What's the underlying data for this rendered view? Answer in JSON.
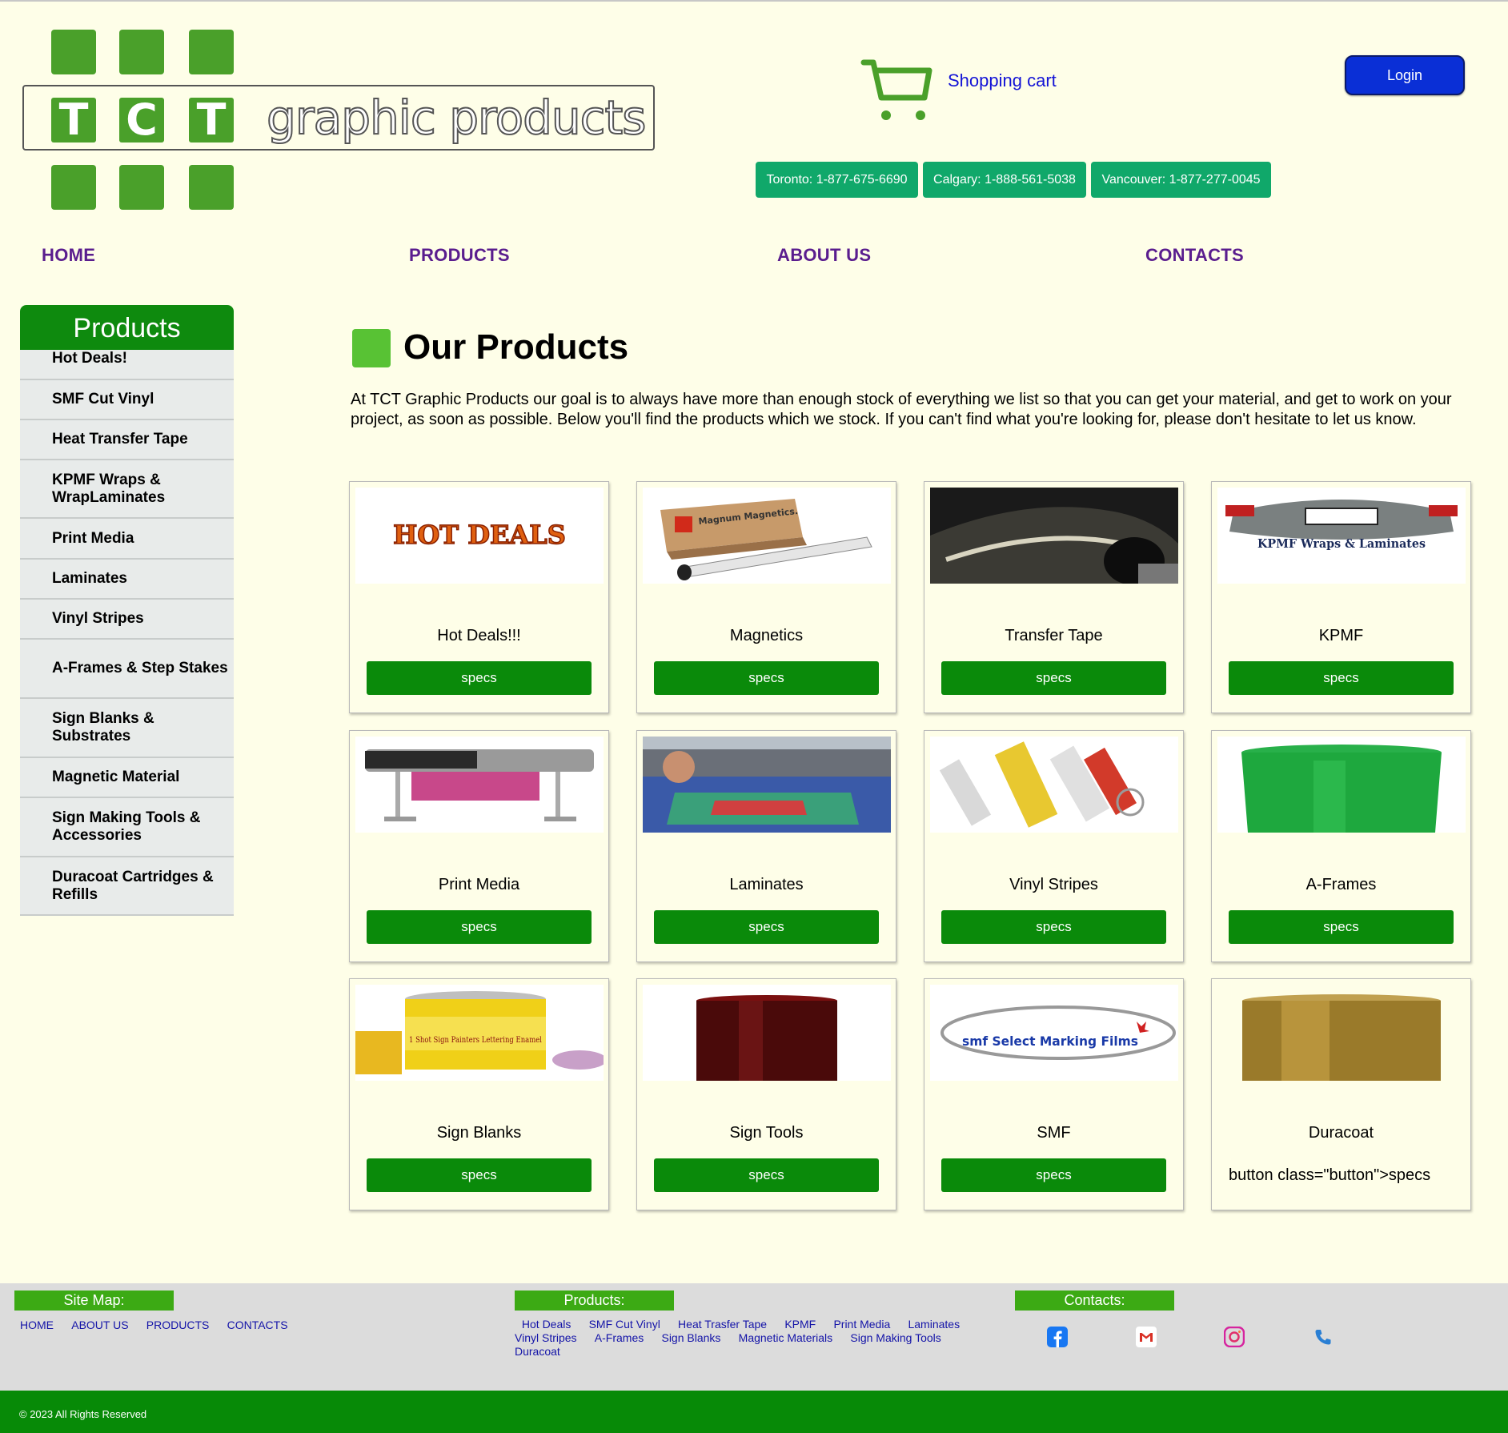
{
  "header": {
    "logo_letters": [
      "T",
      "C",
      "T"
    ],
    "logo_text": "graphic products",
    "cart_label": "Shopping cart",
    "login_label": "Login",
    "phones": [
      "Toronto: 1-877-675-6690",
      "Calgary: 1-888-561-5038",
      "Vancouver: 1-877-277-0045"
    ]
  },
  "nav": [
    "HOME",
    "PRODUCTS",
    "ABOUT US",
    "CONTACTS"
  ],
  "sidebar": {
    "title": "Products",
    "items": [
      "Hot Deals!",
      "SMF Cut Vinyl",
      "Heat Transfer Tape",
      "KPMF Wraps & WrapLaminates",
      "Print Media",
      "Laminates",
      "Vinyl Stripes",
      "A-Frames & Step Stakes",
      "Sign Blanks & Substrates",
      "Magnetic Material",
      "Sign Making Tools & Accessories",
      "Duracoat Cartridges & Refills"
    ]
  },
  "main": {
    "heading": "Our Products",
    "intro": "At TCT Graphic Products our goal is to always have more than enough stock of everything we list so that you can get your material, and get to work on your project, as soon as possible. Below you'll find the products which we stock. If you can't find what you're looking for, please don't hesitate to let us know.",
    "specs_label": "specs",
    "products": [
      {
        "title": "Hot Deals!!!",
        "image_text": "HOT DEALS"
      },
      {
        "title": "Magnetics",
        "image_text": "Magnum Magnetics."
      },
      {
        "title": "Transfer Tape"
      },
      {
        "title": "KPMF",
        "image_text": "KPMF Wraps & Laminates"
      },
      {
        "title": "Print Media"
      },
      {
        "title": "Laminates"
      },
      {
        "title": "Vinyl Stripes"
      },
      {
        "title": "A-Frames"
      },
      {
        "title": "Sign Blanks",
        "image_text": "1 Shot Sign Painters Lettering Enamel"
      },
      {
        "title": "Sign Tools"
      },
      {
        "title": "SMF",
        "image_text": "smf Select Marking Films"
      },
      {
        "title": "Duracoat",
        "raw_text": "button class=\"button\">specs"
      }
    ]
  },
  "footer": {
    "sitemap_title": "Site Map:",
    "sitemap_links": [
      "HOME",
      "ABOUT US",
      "PRODUCTS",
      "CONTACTS"
    ],
    "products_title": "Products:",
    "product_links": [
      "Hot Deals",
      "SMF Cut Vinyl",
      "Heat Trasfer Tape",
      "KPMF",
      "Print Media",
      "Laminates",
      "Vinyl Stripes",
      "A-Frames",
      "Sign Blanks",
      "Magnetic Materials",
      "Sign Making Tools",
      "Duracoat"
    ],
    "contacts_title": "Contacts:",
    "social_icons": [
      "facebook-icon",
      "gmail-icon",
      "instagram-icon",
      "phone-icon"
    ],
    "copyright": "© 2023 All Rights Reserved"
  },
  "colors": {
    "background": "#fefee8",
    "brand_green": "#4aa02a",
    "button_green": "#0a8a0a",
    "nav_purple": "#5a1d8e",
    "login_blue": "#0a2fd6",
    "phone_teal": "#10a86a"
  }
}
